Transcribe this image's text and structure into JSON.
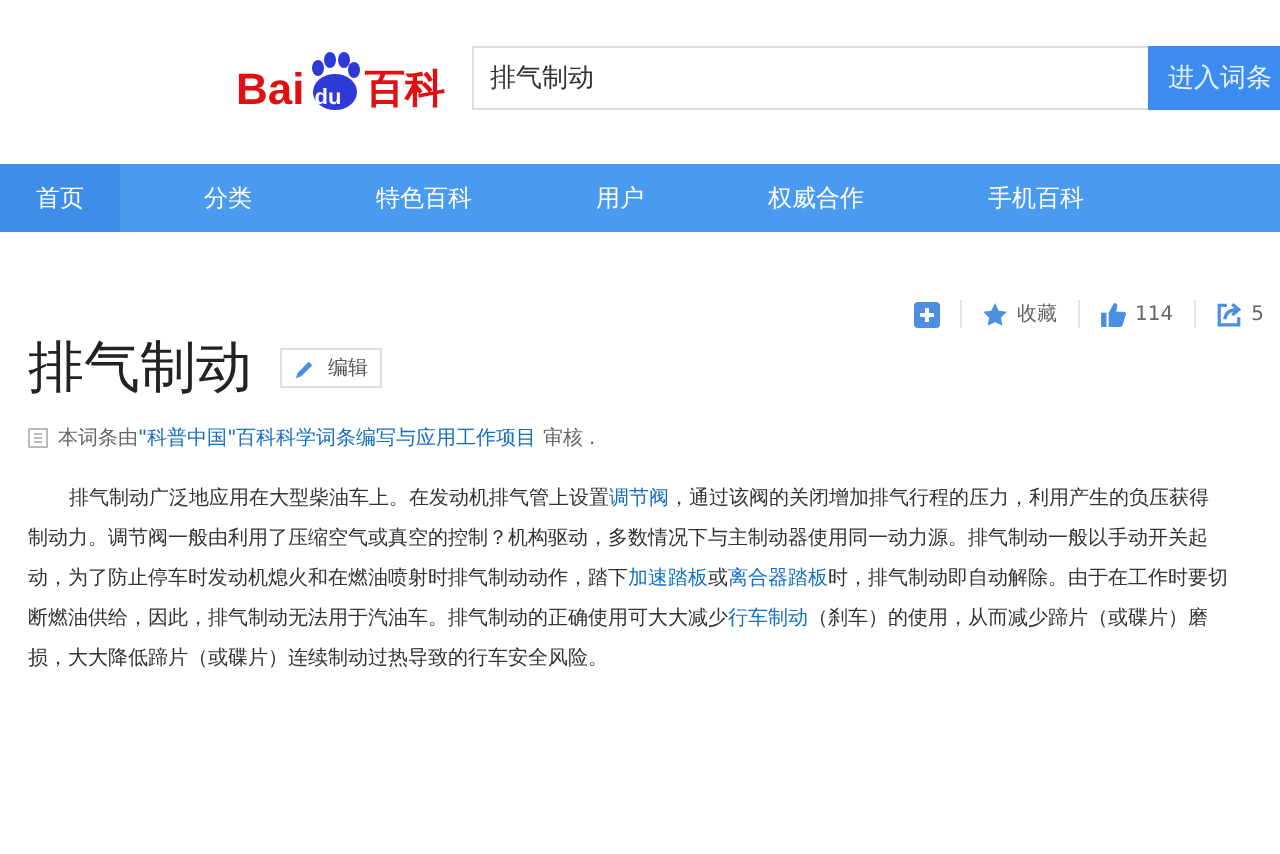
{
  "logo": {
    "part_1": "Bai",
    "part_2": "du",
    "part_3": "百科"
  },
  "search": {
    "value": "排气制动",
    "button": "进入词条"
  },
  "nav": [
    {
      "label": "首页",
      "selected": true
    },
    {
      "label": "分类",
      "selected": false
    },
    {
      "label": "特色百科",
      "selected": false
    },
    {
      "label": "用户",
      "selected": false
    },
    {
      "label": "权威合作",
      "selected": false
    },
    {
      "label": "手机百科",
      "selected": false
    }
  ],
  "actions": {
    "favorite": "收藏",
    "likes": "114",
    "shares": "5"
  },
  "title": "排气制动",
  "edit_button": "编辑",
  "review": [
    {
      "text": "本词条由",
      "link": false
    },
    {
      "text": "\"科普中国\"百科科学词条编写与应用工作项目",
      "link": true
    },
    {
      "text": " 审核 .",
      "link": false
    }
  ],
  "paragraph": [
    {
      "text": "排气制动广泛地应用在大型柴油车上。在发动机排气管上设置",
      "link": false
    },
    {
      "text": "调节阀",
      "link": true
    },
    {
      "text": "，通过该阀的关闭增加排气行程的压力，利用产生的负压获得制动力。调节阀一般由利用了压缩空气或真空的控制？机构驱动，多数情况下与主制动器使用同一动力源。排气制动一般以手动开关起动，为了防止停车时发动机熄火和在燃油喷射时排气制动动作，踏下",
      "link": false
    },
    {
      "text": "加速踏板",
      "link": true
    },
    {
      "text": "或",
      "link": false
    },
    {
      "text": "离合器踏板",
      "link": true
    },
    {
      "text": "时，排气制动即自动解除。由于在工作时要切断燃油供给，因此，排气制动无法用于汽油车。排气制动的正确使用可大大减少",
      "link": false
    },
    {
      "text": "行车制动",
      "link": true
    },
    {
      "text": "（刹车）的使用，从而减少蹄片（或碟片）磨损，大大降低蹄片（或碟片）连续制动过热导致的行车安全风险。",
      "link": false
    }
  ]
}
